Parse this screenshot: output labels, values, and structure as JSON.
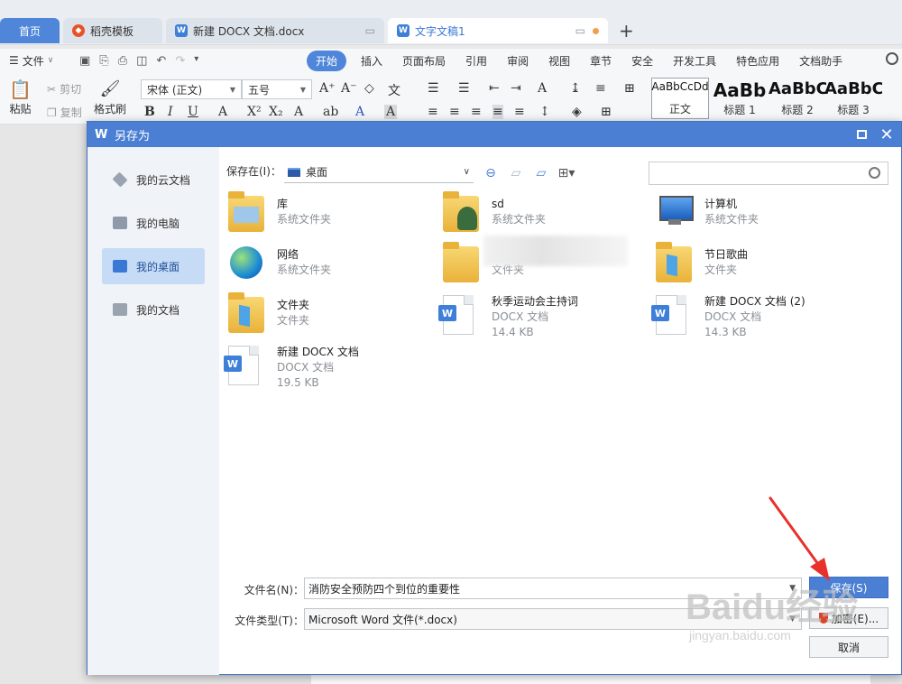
{
  "tabs": [
    {
      "label": "首页"
    },
    {
      "label": "稻壳模板"
    },
    {
      "label": "新建 DOCX 文档.docx"
    },
    {
      "label": "文字文稿1"
    }
  ],
  "menu": {
    "file_label": "文件",
    "items": [
      "开始",
      "插入",
      "页面布局",
      "引用",
      "审阅",
      "视图",
      "章节",
      "安全",
      "开发工具",
      "特色应用",
      "文档助手"
    ]
  },
  "ribbon": {
    "paste": "粘贴",
    "cut": "剪切",
    "copy": "复制",
    "format_painter": "格式刷",
    "font_name": "宋体 (正文)",
    "font_size": "五号",
    "styles": [
      {
        "sample": "AaBbCcDd",
        "label": "正文"
      },
      {
        "sample": "AaBb",
        "label": "标题 1"
      },
      {
        "sample": "AaBbC",
        "label": "标题 2"
      },
      {
        "sample": "AaBbCc",
        "label": "标题 3"
      }
    ]
  },
  "dialog": {
    "title": "另存为",
    "sidebar": [
      {
        "label": "我的云文档"
      },
      {
        "label": "我的电脑"
      },
      {
        "label": "我的桌面"
      },
      {
        "label": "我的文档"
      }
    ],
    "save_in_label": "保存在(I)：",
    "save_in_value": "桌面",
    "files": [
      {
        "name": "库",
        "sub": "系统文件夹",
        "size": ""
      },
      {
        "name": "sd",
        "sub": "系统文件夹",
        "size": ""
      },
      {
        "name": "计算机",
        "sub": "系统文件夹",
        "size": ""
      },
      {
        "name": "网络",
        "sub": "系统文件夹",
        "size": ""
      },
      {
        "name": "",
        "sub": "文件夹",
        "size": ""
      },
      {
        "name": "节日歌曲",
        "sub": "文件夹",
        "size": ""
      },
      {
        "name": "文件夹",
        "sub": "文件夹",
        "size": ""
      },
      {
        "name": "秋季运动会主持词",
        "sub": "DOCX 文档",
        "size": "14.4 KB"
      },
      {
        "name": "新建 DOCX 文档 (2)",
        "sub": "DOCX 文档",
        "size": "14.3 KB"
      },
      {
        "name": "新建 DOCX 文档",
        "sub": "DOCX 文档",
        "size": "19.5 KB"
      }
    ],
    "filename_label": "文件名(N)：",
    "filename_value": "消防安全预防四个到位的重要性",
    "filetype_label": "文件类型(T)：",
    "filetype_value": "Microsoft Word 文件(*.docx)",
    "save_button": "保存(S)",
    "encrypt_button": "加密(E)...",
    "cancel_button": "取消"
  },
  "watermark": {
    "brand": "Baidu经验",
    "url": "jingyan.baidu.com"
  },
  "colors": {
    "accent": "#4a7fd4",
    "active_tab_text": "#3a76d6",
    "arrow": "#e8312b"
  }
}
